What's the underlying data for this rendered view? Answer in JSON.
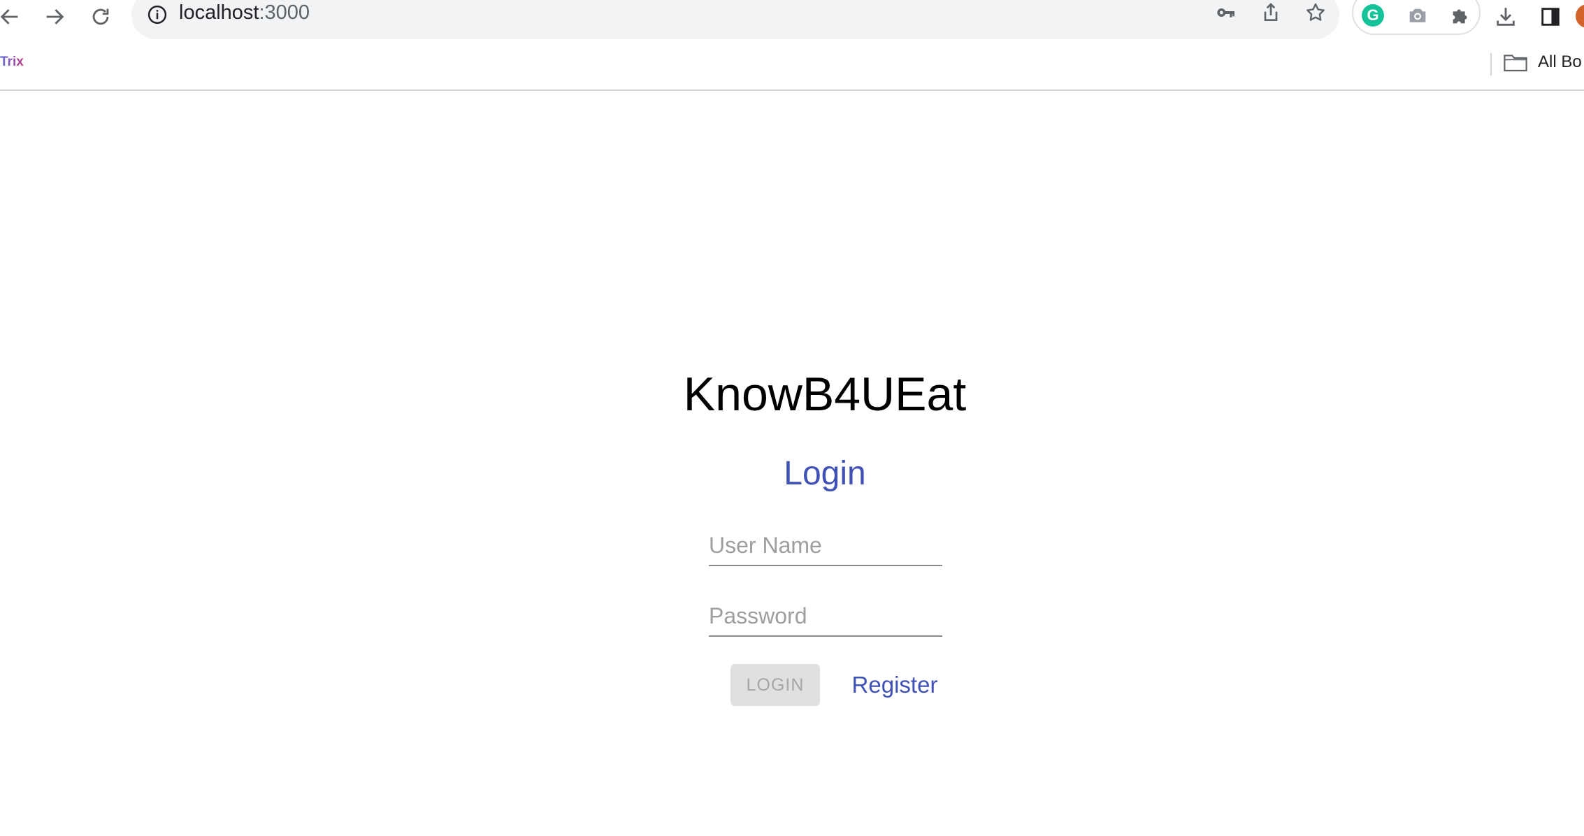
{
  "browser": {
    "url_host": "localhost",
    "url_port": ":3000",
    "extensions": [
      "grammarly-icon",
      "camera-icon",
      "puzzle-icon"
    ],
    "grammarly_letter": "G"
  },
  "bookmarks": {
    "items": [
      {
        "label": "Trix"
      }
    ],
    "all_bookmarks_label": "All Bo"
  },
  "page": {
    "app_title": "KnowB4UEat",
    "heading": "Login",
    "username_placeholder": "User Name",
    "password_placeholder": "Password",
    "login_label": "LOGIN",
    "register_label": "Register"
  },
  "colors": {
    "accent": "#3f51b5",
    "disabled_button_bg": "#e0e0e0",
    "disabled_button_text": "#a6a6a6"
  }
}
